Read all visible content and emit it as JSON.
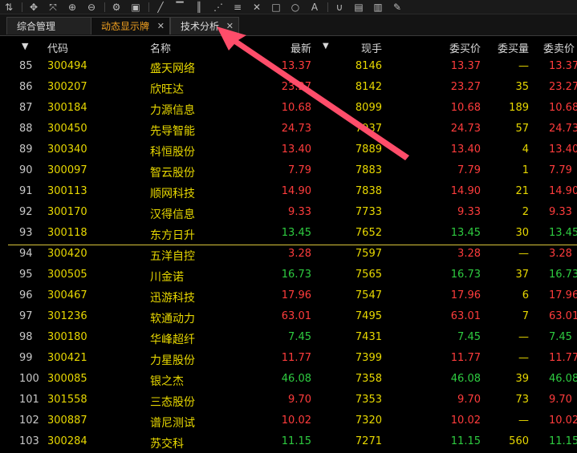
{
  "toolbar": {
    "icons": [
      "sort-icon",
      "move-icon",
      "zoom-fit-icon",
      "zoom-in-icon",
      "zoom-out-icon",
      "settings-icon",
      "lock-icon",
      "line-icon",
      "parallel-icon",
      "channel-icon",
      "fan-icon",
      "fib-icon",
      "cross-icon",
      "rect-icon",
      "circle-icon",
      "text-icon",
      "magnet-icon",
      "save-icon",
      "delete-icon",
      "draw-icon"
    ]
  },
  "tabs": [
    {
      "label": "综合管理"
    },
    {
      "label": "动态显示牌"
    },
    {
      "label": "技术分析"
    }
  ],
  "header": {
    "sort_arrow": "▼",
    "code": "代码",
    "name": "名称",
    "last": "最新",
    "last_sort": "▼",
    "volume": "现手",
    "bid": "委买价",
    "bid_vol": "委买量",
    "ask": "委卖价"
  },
  "colors": {
    "up": "#ff3c3c",
    "down": "#2ecc40",
    "accent": "#f0a020",
    "arrow": "#ff4466"
  },
  "rows": [
    {
      "idx": "85",
      "code": "300494",
      "name": "盛天网络",
      "last": "13.37",
      "vol": "8146",
      "bid": "13.37",
      "bvol": "—",
      "ask": "13.37",
      "dir": "up"
    },
    {
      "idx": "86",
      "code": "300207",
      "name": "欣旺达",
      "last": "23.27",
      "vol": "8142",
      "bid": "23.27",
      "bvol": "35",
      "ask": "23.27",
      "dir": "up"
    },
    {
      "idx": "87",
      "code": "300184",
      "name": "力源信息",
      "last": "10.68",
      "vol": "8099",
      "bid": "10.68",
      "bvol": "189",
      "ask": "10.68",
      "dir": "up"
    },
    {
      "idx": "88",
      "code": "300450",
      "name": "先导智能",
      "last": "24.73",
      "vol": "7937",
      "bid": "24.73",
      "bvol": "57",
      "ask": "24.73",
      "dir": "up"
    },
    {
      "idx": "89",
      "code": "300340",
      "name": "科恒股份",
      "last": "13.40",
      "vol": "7889",
      "bid": "13.40",
      "bvol": "4",
      "ask": "13.40",
      "dir": "up"
    },
    {
      "idx": "90",
      "code": "300097",
      "name": "智云股份",
      "last": "7.79",
      "vol": "7883",
      "bid": "7.79",
      "bvol": "1",
      "ask": "7.79",
      "dir": "up"
    },
    {
      "idx": "91",
      "code": "300113",
      "name": "顺网科技",
      "last": "14.90",
      "vol": "7838",
      "bid": "14.90",
      "bvol": "21",
      "ask": "14.90",
      "dir": "up"
    },
    {
      "idx": "92",
      "code": "300170",
      "name": "汉得信息",
      "last": "9.33",
      "vol": "7733",
      "bid": "9.33",
      "bvol": "2",
      "ask": "9.33",
      "dir": "up"
    },
    {
      "idx": "93",
      "code": "300118",
      "name": "东方日升",
      "last": "13.45",
      "vol": "7652",
      "bid": "13.45",
      "bvol": "30",
      "ask": "13.45",
      "dir": "down"
    },
    {
      "idx": "94",
      "code": "300420",
      "name": "五洋自控",
      "last": "3.28",
      "vol": "7597",
      "bid": "3.28",
      "bvol": "—",
      "ask": "3.28",
      "dir": "up"
    },
    {
      "idx": "95",
      "code": "300505",
      "name": "川金诺",
      "last": "16.73",
      "vol": "7565",
      "bid": "16.73",
      "bvol": "37",
      "ask": "16.73",
      "dir": "down"
    },
    {
      "idx": "96",
      "code": "300467",
      "name": "迅游科技",
      "last": "17.96",
      "vol": "7547",
      "bid": "17.96",
      "bvol": "6",
      "ask": "17.96",
      "dir": "up"
    },
    {
      "idx": "97",
      "code": "301236",
      "name": "软通动力",
      "last": "63.01",
      "vol": "7495",
      "bid": "63.01",
      "bvol": "7",
      "ask": "63.01",
      "dir": "up"
    },
    {
      "idx": "98",
      "code": "300180",
      "name": "华峰超纤",
      "last": "7.45",
      "vol": "7431",
      "bid": "7.45",
      "bvol": "—",
      "ask": "7.45",
      "dir": "down"
    },
    {
      "idx": "99",
      "code": "300421",
      "name": "力星股份",
      "last": "11.77",
      "vol": "7399",
      "bid": "11.77",
      "bvol": "—",
      "ask": "11.77",
      "dir": "up"
    },
    {
      "idx": "100",
      "code": "300085",
      "name": "银之杰",
      "last": "46.08",
      "vol": "7358",
      "bid": "46.08",
      "bvol": "39",
      "ask": "46.08",
      "dir": "down"
    },
    {
      "idx": "101",
      "code": "301558",
      "name": "三态股份",
      "last": "9.70",
      "vol": "7353",
      "bid": "9.70",
      "bvol": "73",
      "ask": "9.70",
      "dir": "up"
    },
    {
      "idx": "102",
      "code": "300887",
      "name": "谱尼测试",
      "last": "10.02",
      "vol": "7320",
      "bid": "10.02",
      "bvol": "—",
      "ask": "10.02",
      "dir": "up"
    },
    {
      "idx": "103",
      "code": "300284",
      "name": "苏交科",
      "last": "11.15",
      "vol": "7271",
      "bid": "11.15",
      "bvol": "560",
      "ask": "11.15",
      "dir": "down"
    }
  ]
}
